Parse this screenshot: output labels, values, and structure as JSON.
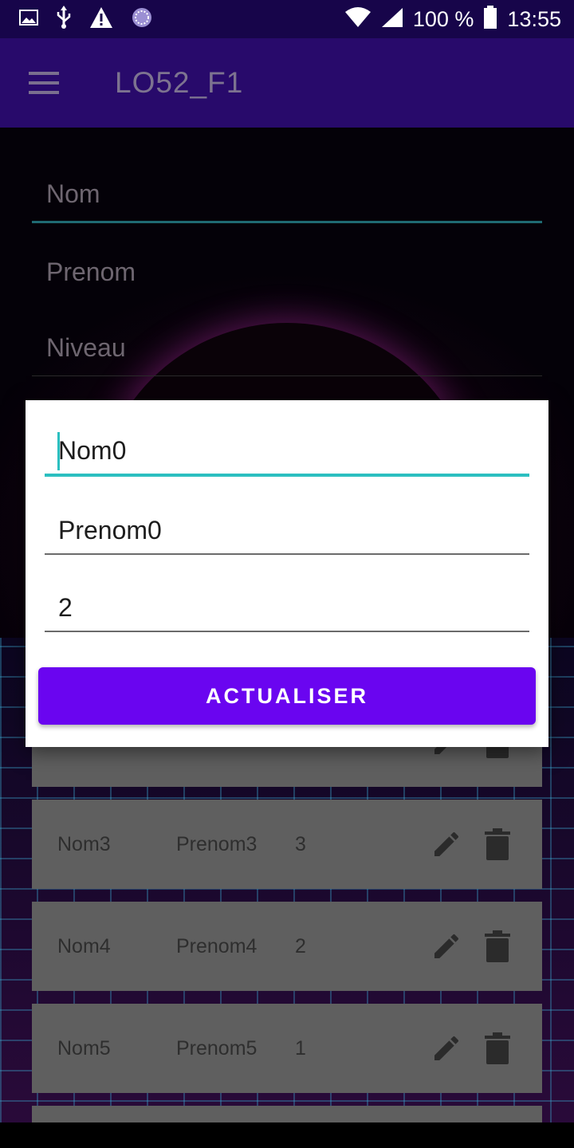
{
  "status_bar": {
    "battery_text": "100 %",
    "time": "13:55",
    "icons": [
      "image-icon",
      "usb-icon",
      "warning-icon",
      "sync-icon",
      "wifi-icon",
      "signal-icon",
      "battery-icon"
    ]
  },
  "app_bar": {
    "title": "LO52_F1",
    "menu_icon": "hamburger-menu-icon"
  },
  "form": {
    "nom_placeholder": "Nom",
    "prenom_placeholder": "Prenom",
    "niveau_placeholder": "Niveau"
  },
  "list": {
    "rows": [
      {
        "nom": "Nom3",
        "prenom": "Prenom3",
        "niveau": "3"
      },
      {
        "nom": "Nom4",
        "prenom": "Prenom4",
        "niveau": "2"
      },
      {
        "nom": "Nom5",
        "prenom": "Prenom5",
        "niveau": "1"
      }
    ]
  },
  "dialog": {
    "nom_value": "Nom0",
    "prenom_value": "Prenom0",
    "niveau_value": "2",
    "button_label": "ACTUALISER"
  },
  "colors": {
    "status_bar": "#17054a",
    "app_bar": "#280a6b",
    "accent": "#2bbfc0",
    "button": "#6a05f0",
    "row_bg": "#5f5f5f"
  }
}
